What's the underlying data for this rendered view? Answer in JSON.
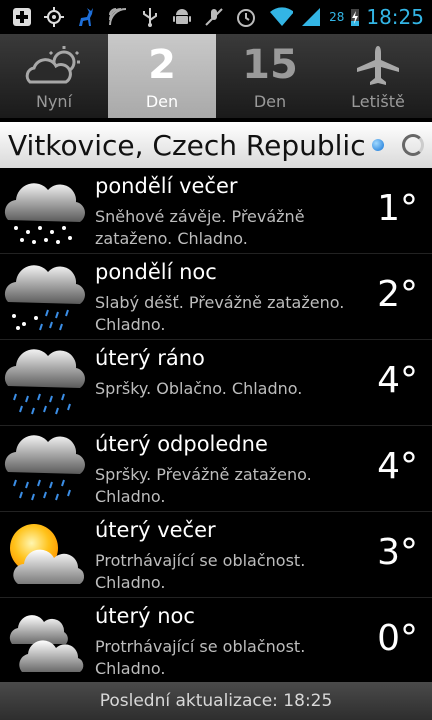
{
  "status_bar": {
    "time": "18:25",
    "battery": "28",
    "icons": [
      "plus-box-icon",
      "gps-icon",
      "deer-icon",
      "signal-arcs-icon",
      "usb-icon",
      "android-icon",
      "no-mic-icon",
      "alarm-icon",
      "wifi-icon",
      "cell-signal-icon",
      "battery-charging-icon"
    ]
  },
  "tabs": [
    {
      "label": "Nyní",
      "icon": "cloud-sun-icon"
    },
    {
      "label": "Den",
      "number": "2",
      "active": true
    },
    {
      "label": "Den",
      "number": "15"
    },
    {
      "label": "Letiště",
      "icon": "airplane-icon"
    }
  ],
  "location": {
    "name": "Vitkovice, Czech Republic"
  },
  "forecast": [
    {
      "title": "pondělí večer",
      "desc": "Sněhové závěje. Převážně zataženo. Chladno.",
      "temp": "1°",
      "icon": "snow-cloud-icon"
    },
    {
      "title": "pondělí noc",
      "desc": "Slabý déšť. Převážně zataženo. Chladno.",
      "temp": "2°",
      "icon": "sleet-cloud-icon"
    },
    {
      "title": "úterý ráno",
      "desc": "Spršky. Oblačno. Chladno.",
      "temp": "4°",
      "icon": "rain-cloud-icon"
    },
    {
      "title": "úterý odpoledne",
      "desc": "Spršky. Převážně zataženo. Chladno.",
      "temp": "4°",
      "icon": "rain-cloud-icon"
    },
    {
      "title": "úterý večer",
      "desc": "Protrhávající se oblačnost. Chladno.",
      "temp": "3°",
      "icon": "sun-cloud-icon"
    },
    {
      "title": "úterý noc",
      "desc": "Protrhávající se oblačnost. Chladno.",
      "temp": "0°",
      "icon": "clouds-icon"
    }
  ],
  "footer": {
    "text": "Poslední aktualizace: 18:25"
  }
}
